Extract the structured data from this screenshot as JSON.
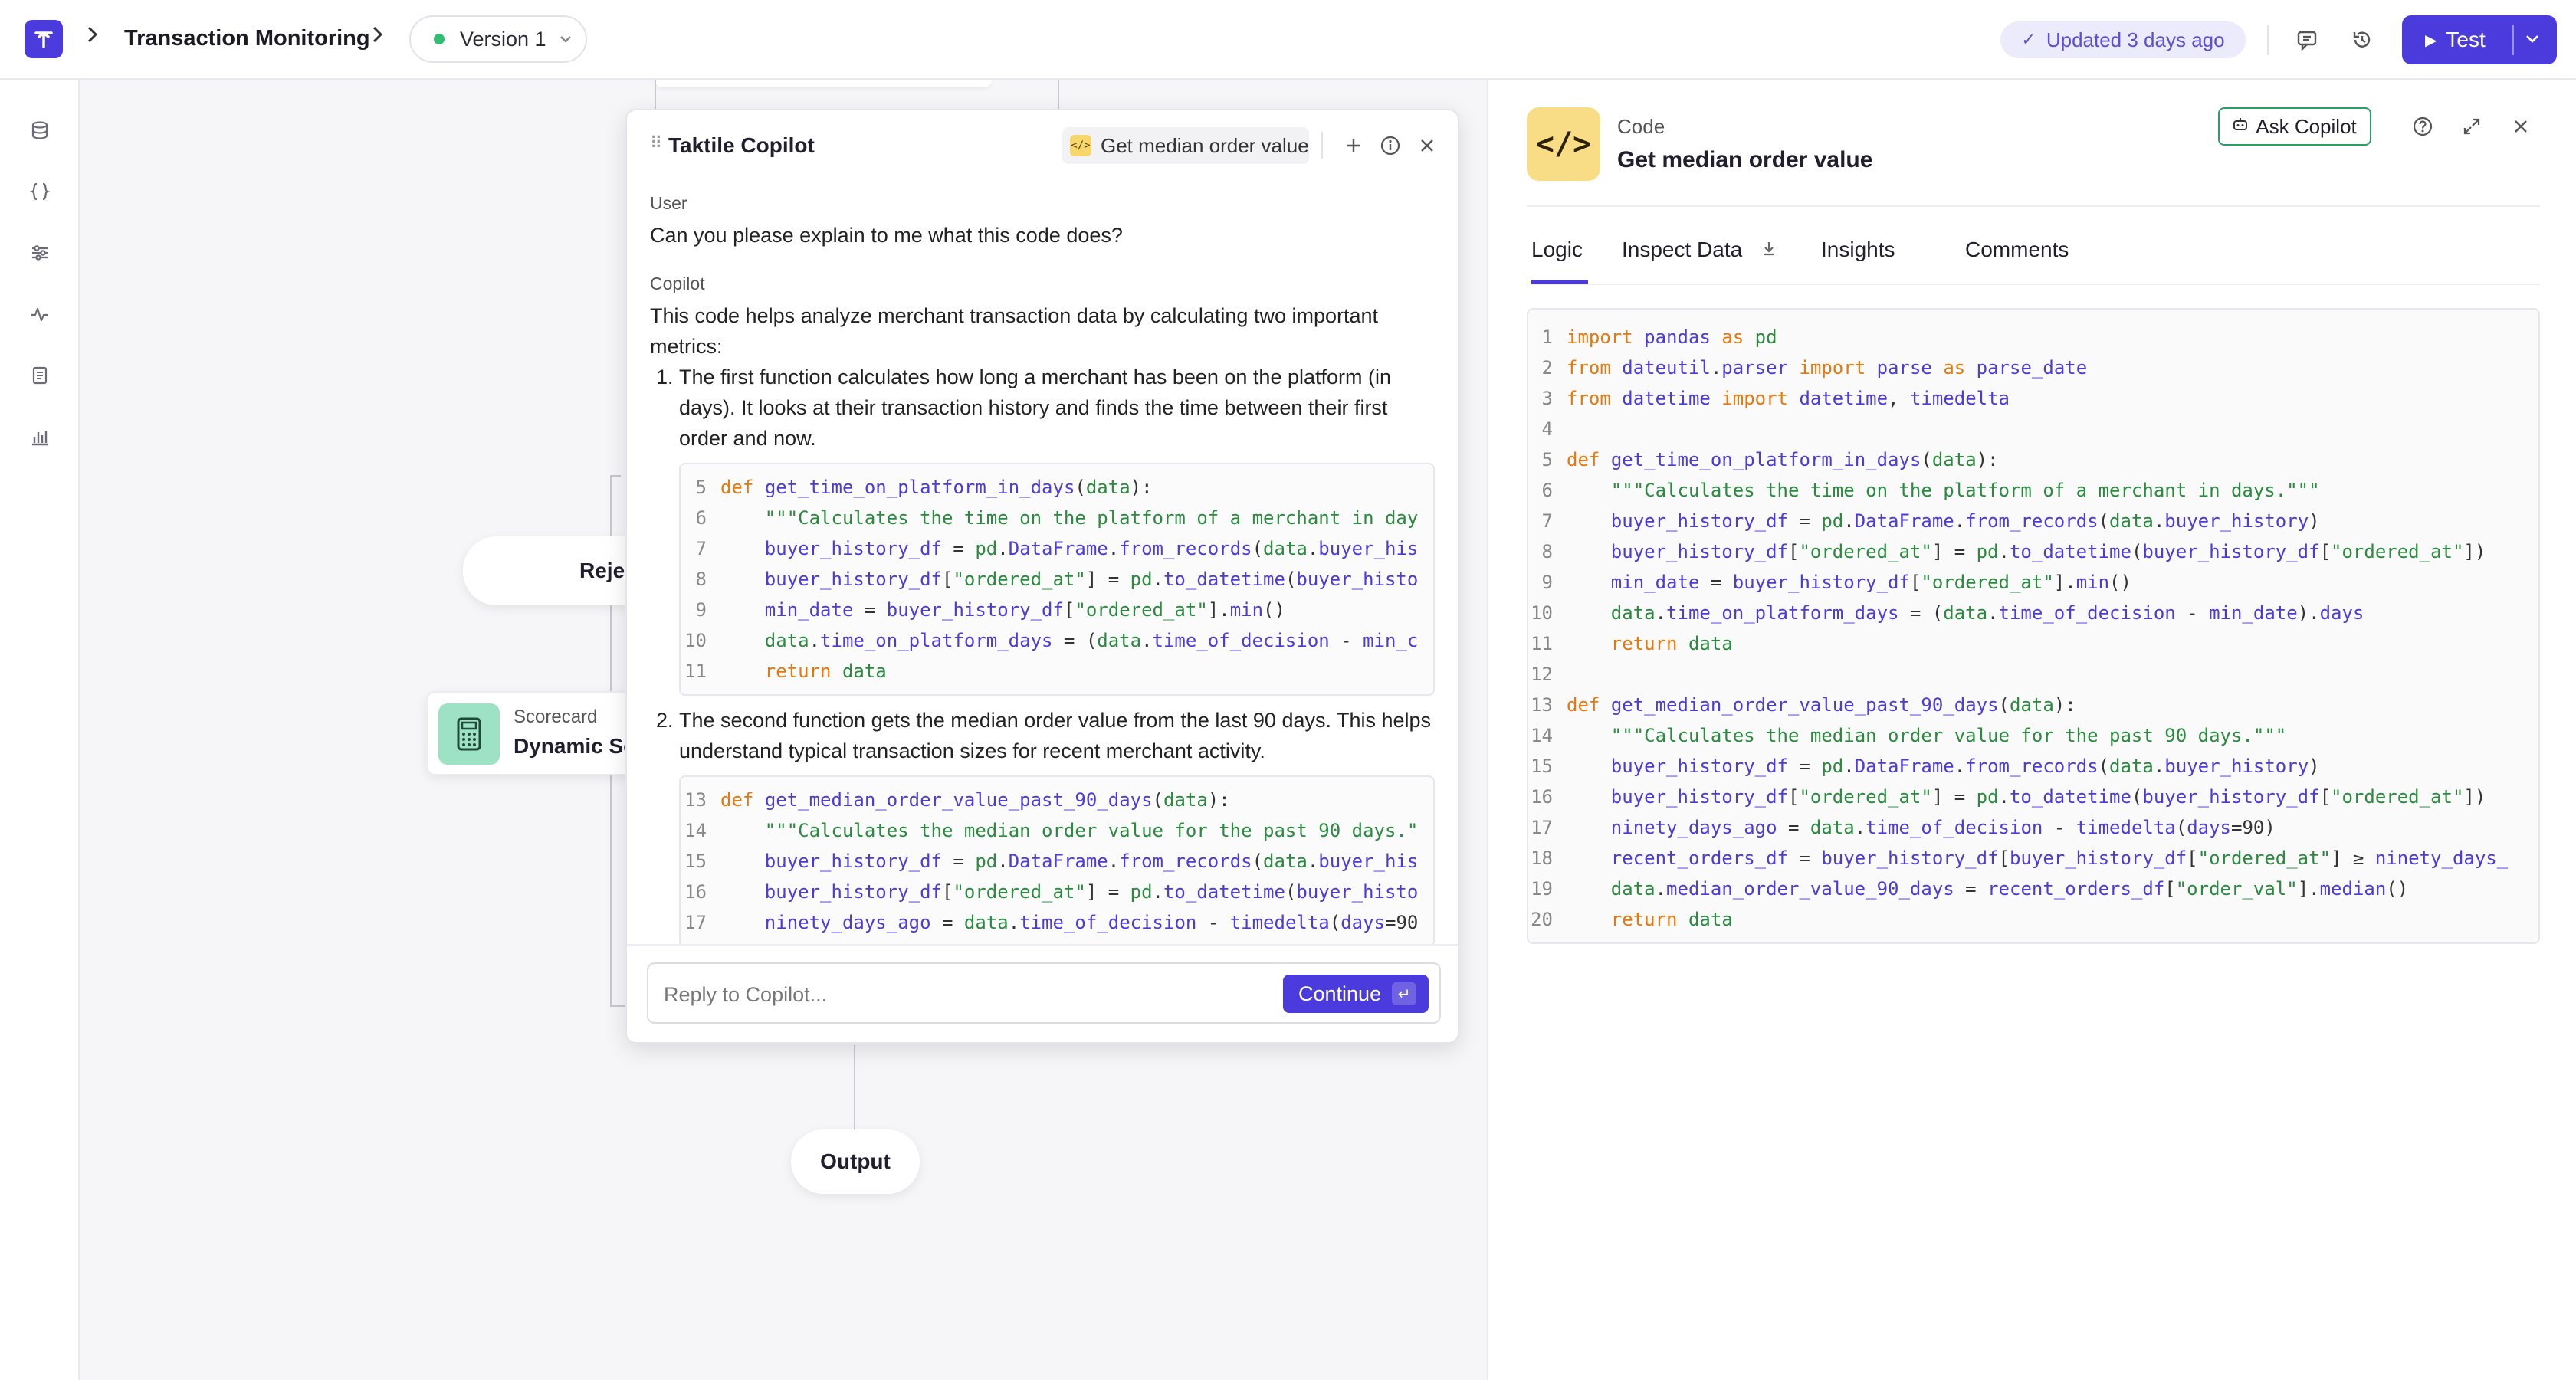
{
  "topbar": {
    "breadcrumb_title": "Transaction Monitoring",
    "version_label": "Version 1",
    "updated_label": "Updated 3 days ago",
    "test_label": "Test"
  },
  "canvas": {
    "reject_label": "Rejec",
    "scorecard_type": "Scorecard",
    "scorecard_title": "Dynamic Sc",
    "output_label": "Output"
  },
  "copilot": {
    "title": "Taktile Copilot",
    "context_label": "Get median order value",
    "user_role": "User",
    "user_message": "Can you please explain to me what this code does?",
    "copilot_role": "Copilot",
    "intro": "This code helps analyze merchant transaction data by calculating two important metrics:",
    "items": [
      {
        "number": "1.",
        "text": "The first function calculates how long a merchant has been on the platform (in days). It looks at their transaction history and finds the time between their first order and now.",
        "code": [
          {
            "ln": "5",
            "text": "def get_time_on_platform_in_days(data):"
          },
          {
            "ln": "6",
            "text": "    \"\"\"Calculates the time on the platform of a merchant in day"
          },
          {
            "ln": "7",
            "text": "    buyer_history_df = pd.DataFrame.from_records(data.buyer_his"
          },
          {
            "ln": "8",
            "text": "    buyer_history_df[\"ordered_at\"] = pd.to_datetime(buyer_histo"
          },
          {
            "ln": "9",
            "text": "    min_date = buyer_history_df[\"ordered_at\"].min()"
          },
          {
            "ln": "10",
            "text": "    data.time_on_platform_days = (data.time_of_decision - min_c"
          },
          {
            "ln": "11",
            "text": "    return data"
          }
        ]
      },
      {
        "number": "2.",
        "text": "The second function gets the median order value from the last 90 days. This helps understand typical transaction sizes for recent merchant activity.",
        "code": [
          {
            "ln": "13",
            "text": "def get_median_order_value_past_90_days(data):"
          },
          {
            "ln": "14",
            "text": "    \"\"\"Calculates the median order value for the past 90 days.\""
          },
          {
            "ln": "15",
            "text": "    buyer_history_df = pd.DataFrame.from_records(data.buyer_his"
          },
          {
            "ln": "16",
            "text": "    buyer_history_df[\"ordered_at\"] = pd.to_datetime(buyer_histo"
          },
          {
            "ln": "17",
            "text": "    ninety_days_ago = data.time_of_decision - timedelta(days=90"
          }
        ]
      }
    ],
    "reply_placeholder": "Reply to Copilot...",
    "continue_label": "Continue",
    "enter_glyph": "↵"
  },
  "panel": {
    "type_label": "Code",
    "title": "Get median order value",
    "ask_label": "Ask Copilot",
    "tabs": [
      "Logic",
      "Inspect Data",
      "Insights",
      "Comments"
    ],
    "code": [
      {
        "ln": "1",
        "text": "import pandas as pd"
      },
      {
        "ln": "2",
        "text": "from dateutil.parser import parse as parse_date"
      },
      {
        "ln": "3",
        "text": "from datetime import datetime, timedelta"
      },
      {
        "ln": "4",
        "text": ""
      },
      {
        "ln": "5",
        "text": "def get_time_on_platform_in_days(data):"
      },
      {
        "ln": "6",
        "text": "    \"\"\"Calculates the time on the platform of a merchant in days.\"\"\""
      },
      {
        "ln": "7",
        "text": "    buyer_history_df = pd.DataFrame.from_records(data.buyer_history)"
      },
      {
        "ln": "8",
        "text": "    buyer_history_df[\"ordered_at\"] = pd.to_datetime(buyer_history_df[\"ordered_at\"])"
      },
      {
        "ln": "9",
        "text": "    min_date = buyer_history_df[\"ordered_at\"].min()"
      },
      {
        "ln": "10",
        "text": "    data.time_on_platform_days = (data.time_of_decision - min_date).days"
      },
      {
        "ln": "11",
        "text": "    return data"
      },
      {
        "ln": "12",
        "text": ""
      },
      {
        "ln": "13",
        "text": "def get_median_order_value_past_90_days(data):"
      },
      {
        "ln": "14",
        "text": "    \"\"\"Calculates the median order value for the past 90 days.\"\"\""
      },
      {
        "ln": "15",
        "text": "    buyer_history_df = pd.DataFrame.from_records(data.buyer_history)"
      },
      {
        "ln": "16",
        "text": "    buyer_history_df[\"ordered_at\"] = pd.to_datetime(buyer_history_df[\"ordered_at\"])"
      },
      {
        "ln": "17",
        "text": "    ninety_days_ago = data.time_of_decision - timedelta(days=90)"
      },
      {
        "ln": "18",
        "text": "    recent_orders_df = buyer_history_df[buyer_history_df[\"ordered_at\"] ≥ ninety_days_"
      },
      {
        "ln": "19",
        "text": "    data.median_order_value_90_days = recent_orders_df[\"order_val\"].median()"
      },
      {
        "ln": "20",
        "text": "    return data"
      }
    ]
  },
  "colors": {
    "accent": "#4b3bdc",
    "status_green": "#2fbf71",
    "code_badge": "#f9dd86",
    "scorecard_icon": "#9de2c4"
  }
}
